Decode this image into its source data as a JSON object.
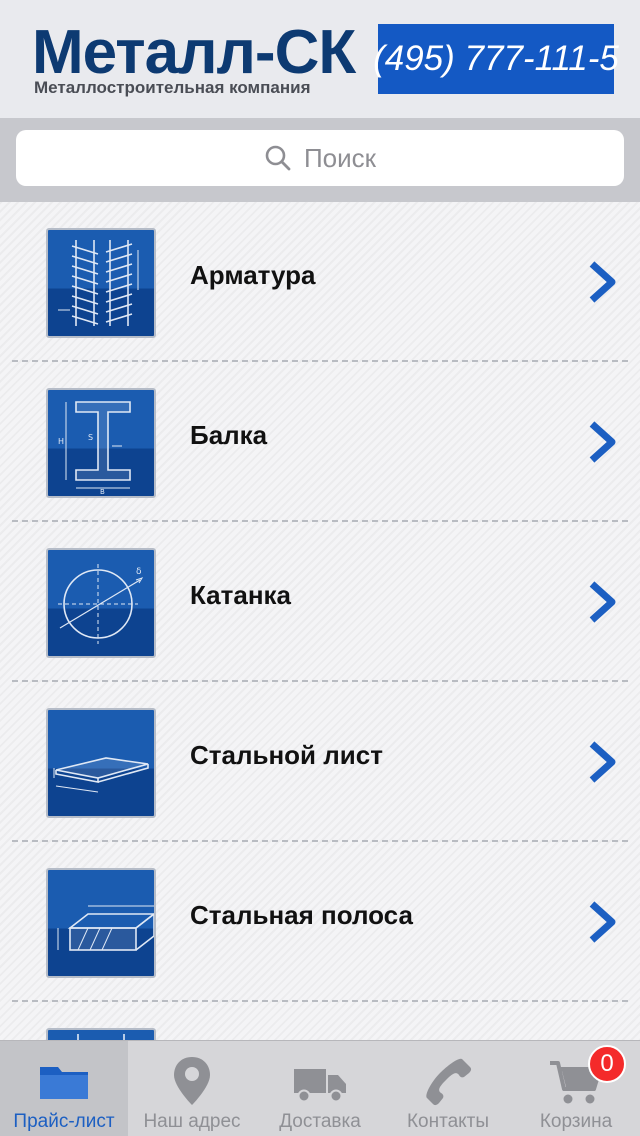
{
  "header": {
    "logo_title": "Металл-СК",
    "logo_subtitle": "Металлостроительная компания",
    "phone": "(495) 777-111-5"
  },
  "search": {
    "placeholder": "Поиск",
    "icon": "search-icon"
  },
  "catalog": {
    "items": [
      {
        "label": "Арматура",
        "icon": "rebar-icon"
      },
      {
        "label": "Балка",
        "icon": "i-beam-icon"
      },
      {
        "label": "Катанка",
        "icon": "wire-rod-icon"
      },
      {
        "label": "Стальной лист",
        "icon": "steel-sheet-icon"
      },
      {
        "label": "Стальная полоса",
        "icon": "steel-strip-icon"
      }
    ]
  },
  "tabbar": {
    "tabs": [
      {
        "label": "Прайс-лист",
        "icon": "folder-icon",
        "active": true
      },
      {
        "label": "Наш адрес",
        "icon": "map-pin-icon",
        "active": false
      },
      {
        "label": "Доставка",
        "icon": "truck-icon",
        "active": false
      },
      {
        "label": "Контакты",
        "icon": "phone-icon",
        "active": false
      },
      {
        "label": "Корзина",
        "icon": "cart-icon",
        "active": false,
        "badge": "0"
      }
    ]
  },
  "colors": {
    "brand_dark": "#0d3a72",
    "phone_bg": "#1459c4",
    "accent": "#1c5fc2",
    "badge": "#f42a2a"
  }
}
